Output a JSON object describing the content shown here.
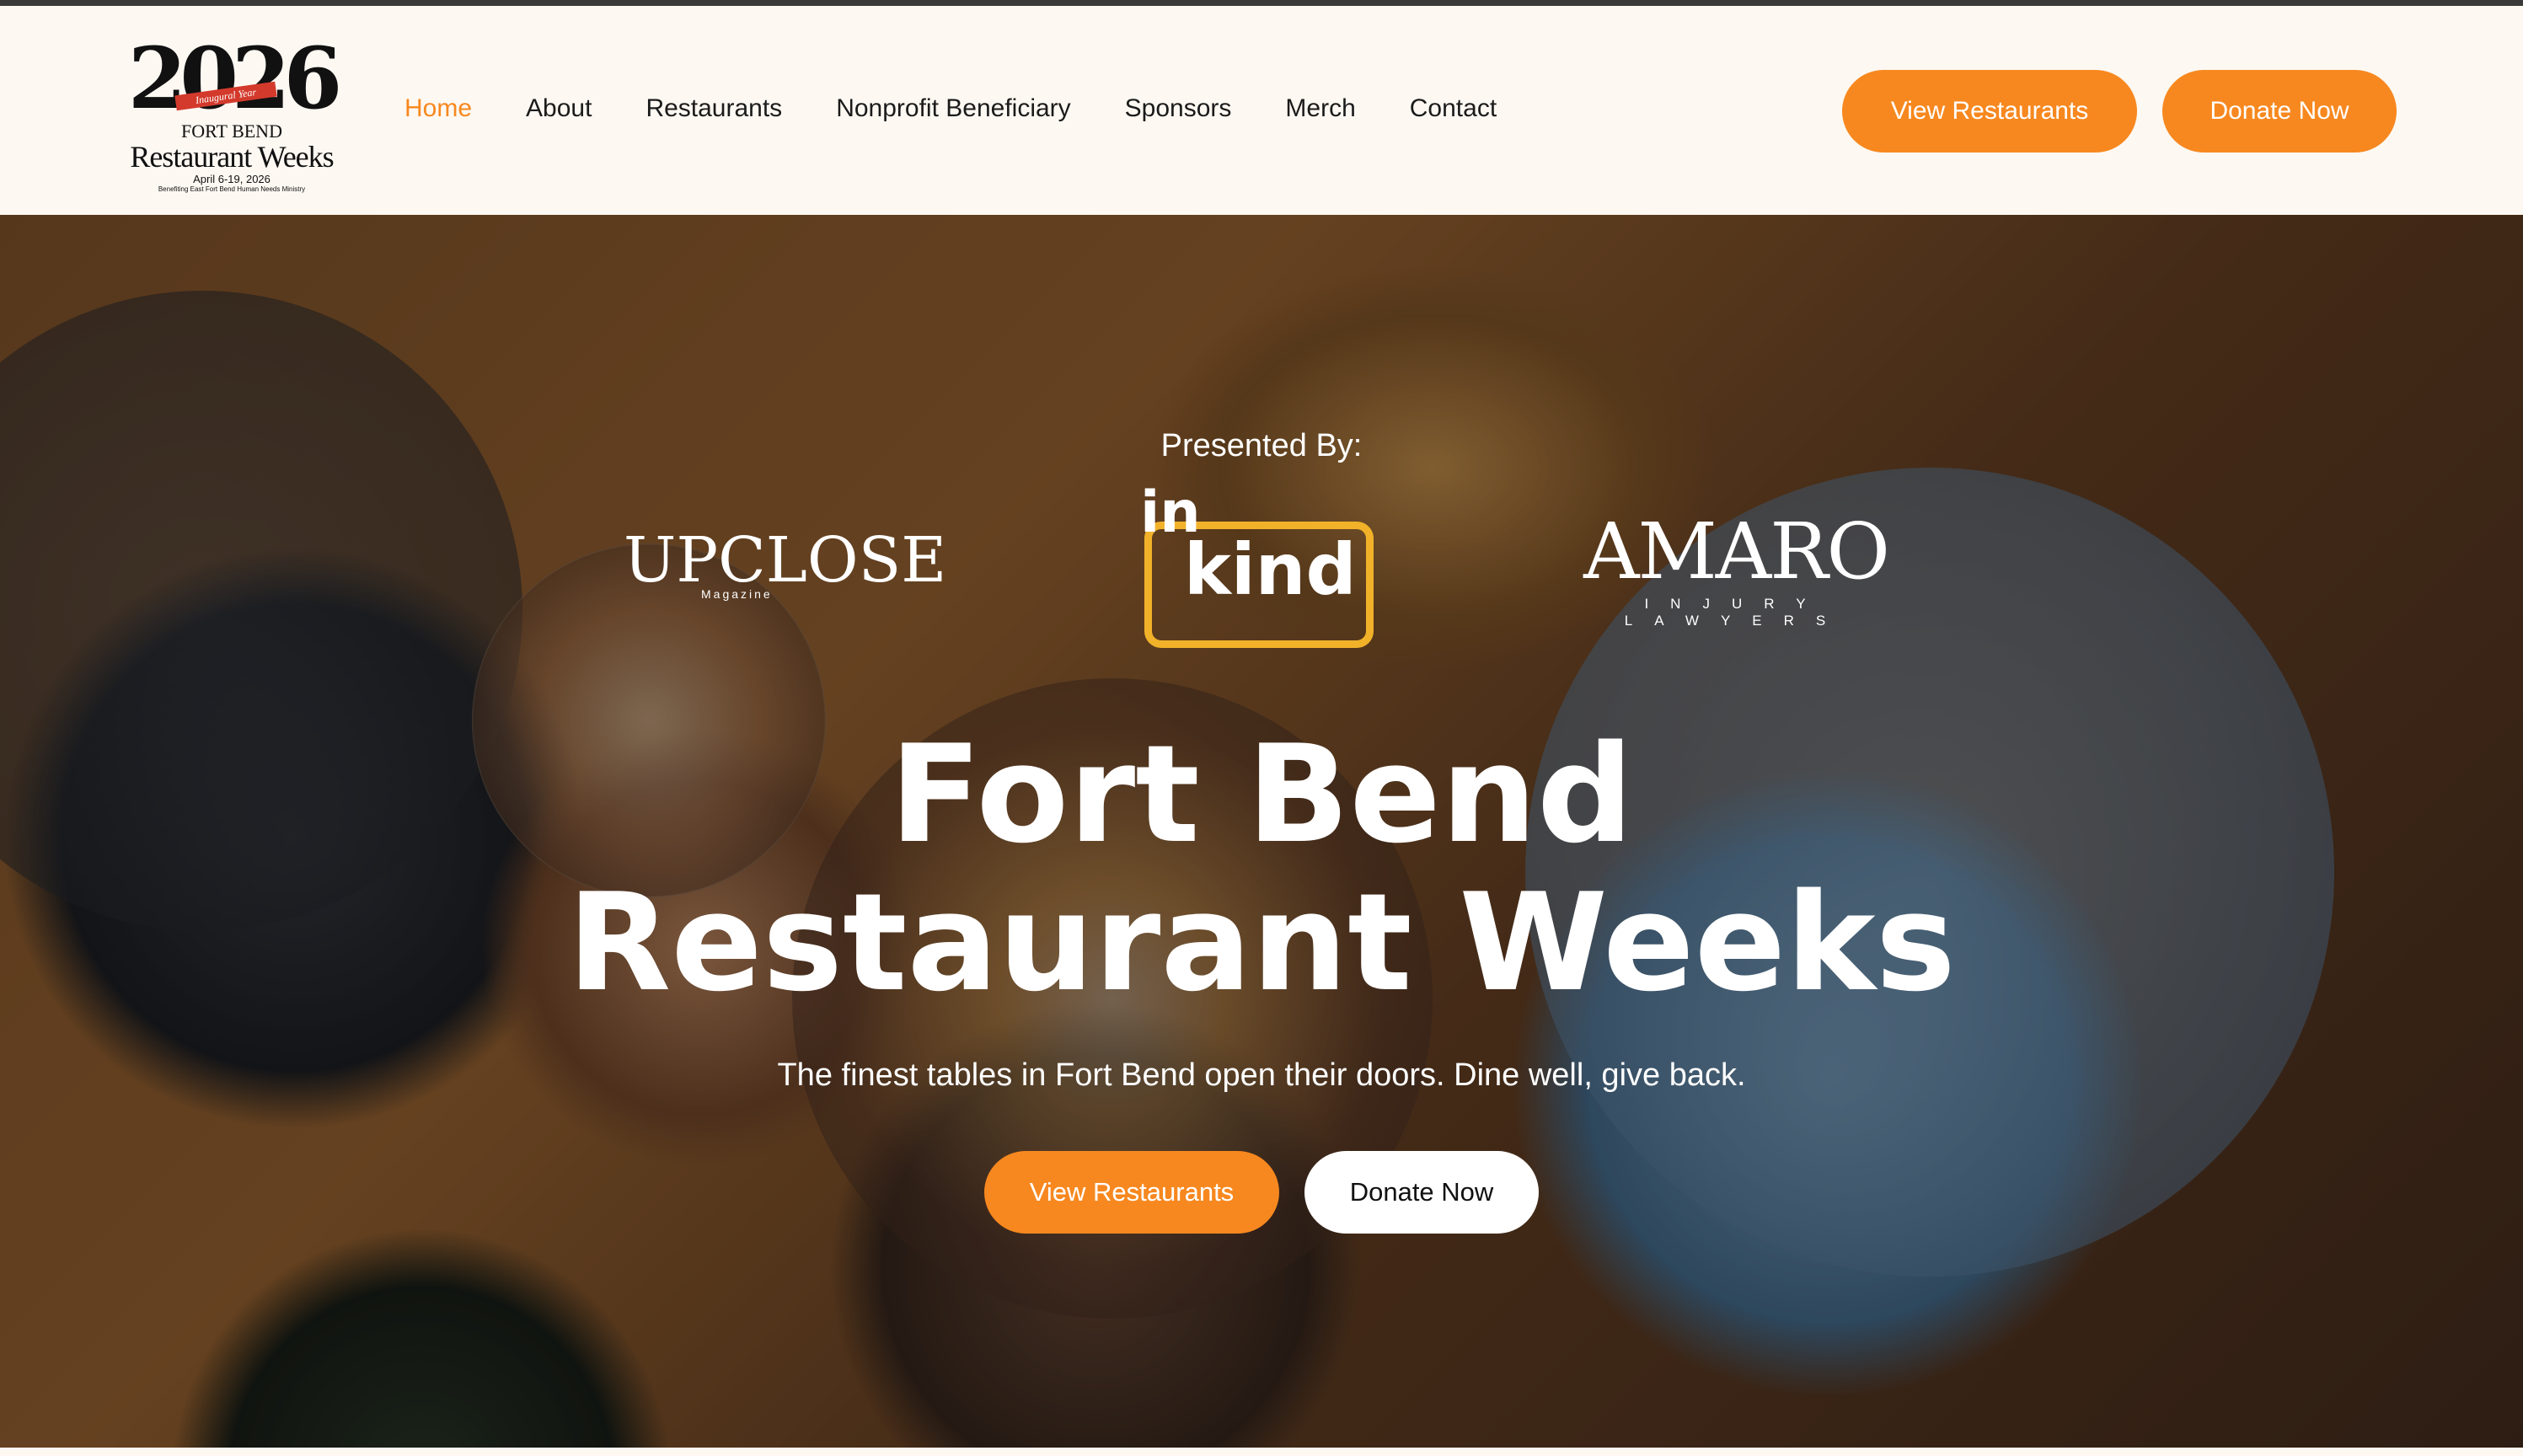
{
  "logo": {
    "year": "2026",
    "ribbon": "Inaugural Year",
    "line1": "FORT BEND",
    "line2": "Restaurant Weeks",
    "dates": "April 6-19, 2026",
    "benefit": "Benefiting East Fort Bend Human Needs Ministry"
  },
  "nav": {
    "items": [
      "Home",
      "About",
      "Restaurants",
      "Nonprofit Beneficiary",
      "Sponsors",
      "Merch",
      "Contact"
    ],
    "active": "Home"
  },
  "header_buttons": {
    "view": "View Restaurants",
    "donate": "Donate Now"
  },
  "colors": {
    "accent": "#f7881f",
    "background": "#fdf8f2",
    "inkind_yellow": "#f1b22a"
  },
  "hero": {
    "presented_by": "Presented By:",
    "sponsors": {
      "upclose": "UPCLOSE",
      "upclose_sub": "Magazine",
      "inkind_in": "in",
      "inkind_kind": "kind",
      "amaro": "AMARO",
      "amaro_sub": "INJURY LAWYERS"
    },
    "title_line1": "Fort Bend",
    "title_line2": "Restaurant Weeks",
    "subtitle": "The finest tables in Fort Bend open their doors. Dine well, give back.",
    "button_view": "View Restaurants",
    "button_donate": "Donate Now"
  }
}
